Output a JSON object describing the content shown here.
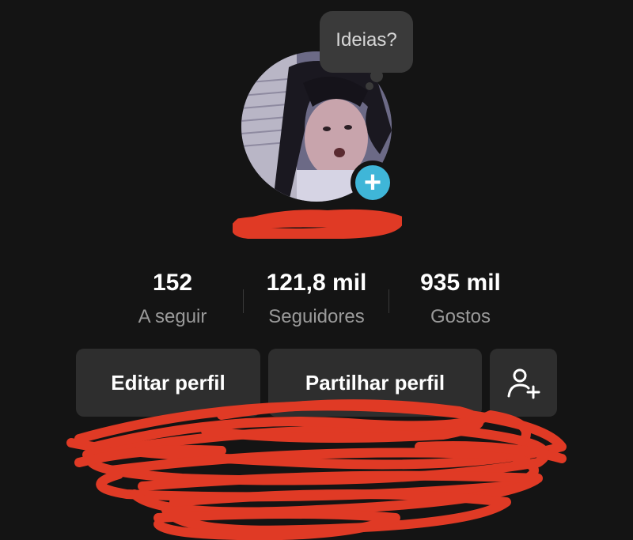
{
  "bubble": {
    "text": "Ideias?"
  },
  "profile": {
    "add_icon": "plus-icon",
    "colors": {
      "accent": "#3fb6d8",
      "redaction": "#e03a25",
      "background": "#141414",
      "button": "#2e2e2e"
    }
  },
  "stats": [
    {
      "value": "152",
      "label": "A seguir"
    },
    {
      "value": "121,8 mil",
      "label": "Seguidores"
    },
    {
      "value": "935 mil",
      "label": "Gostos"
    }
  ],
  "buttons": {
    "edit": "Editar perfil",
    "share": "Partilhar perfil",
    "add_friend_icon": "add-person-icon"
  }
}
